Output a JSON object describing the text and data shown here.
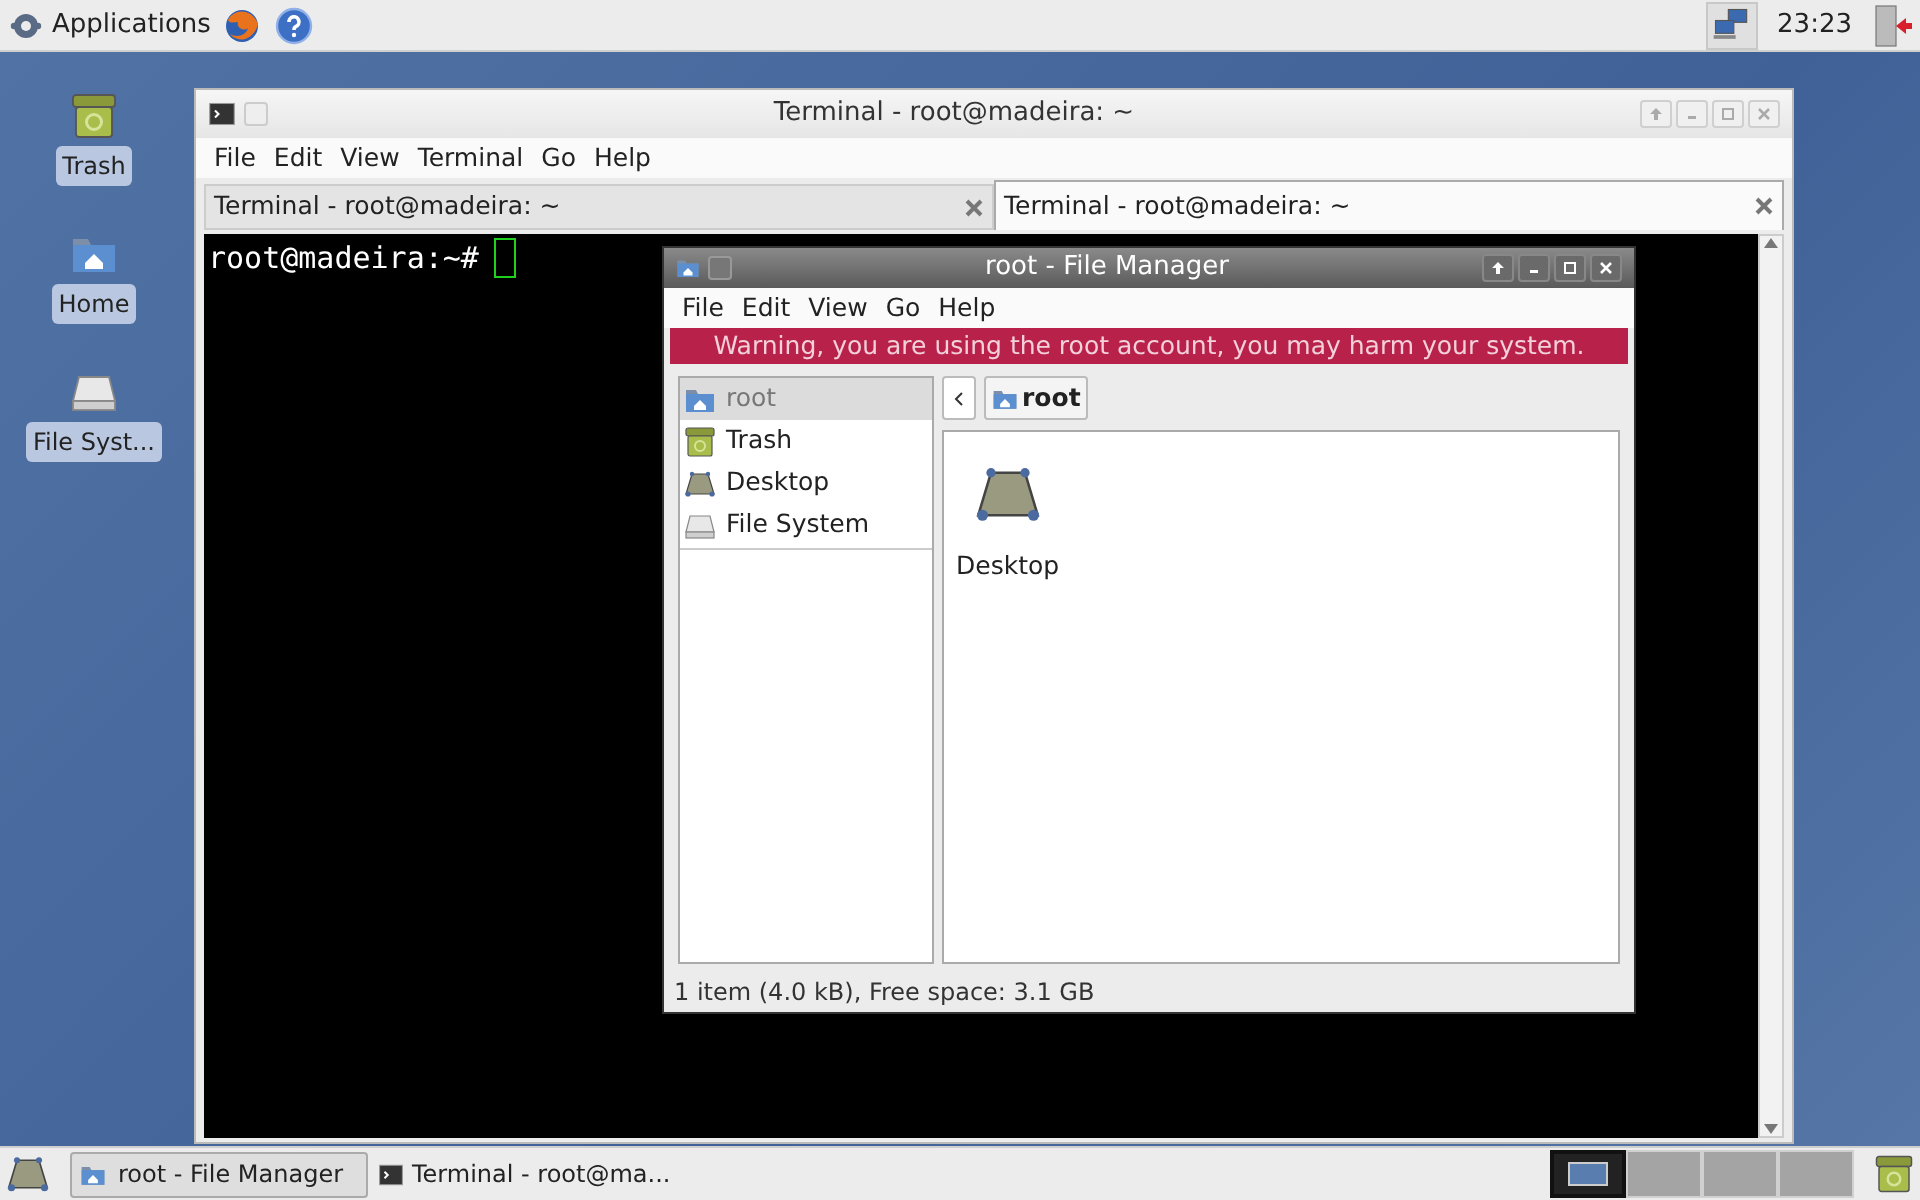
{
  "top_panel": {
    "applications_menu": "Applications",
    "clock": "23:23"
  },
  "desktop_icons": [
    {
      "label": "Trash",
      "kind": "trash"
    },
    {
      "label": "Home",
      "kind": "home"
    },
    {
      "label": "File Syst...",
      "kind": "drive"
    }
  ],
  "terminal_window": {
    "title": "Terminal - root@madeira: ~",
    "menu": [
      "File",
      "Edit",
      "View",
      "Terminal",
      "Go",
      "Help"
    ],
    "tabs": [
      {
        "label": "Terminal - root@madeira: ~",
        "selected": false
      },
      {
        "label": "Terminal - root@madeira: ~",
        "selected": true
      }
    ],
    "prompt": "root@madeira:~#"
  },
  "file_manager": {
    "title": "root - File Manager",
    "menu": [
      "File",
      "Edit",
      "View",
      "Go",
      "Help"
    ],
    "warning": "Warning, you are using the root account, you may harm your system.",
    "sidebar": [
      {
        "label": "root",
        "kind": "home",
        "selected": true
      },
      {
        "label": "Trash",
        "kind": "trash",
        "selected": false
      },
      {
        "label": "Desktop",
        "kind": "desktop",
        "selected": false
      },
      {
        "label": "File System",
        "kind": "drive",
        "selected": false
      }
    ],
    "path_button": "root",
    "items": [
      {
        "label": "Desktop",
        "kind": "desktop"
      }
    ],
    "status": "1 item (4.0 kB), Free space: 3.1 GB"
  },
  "taskbar": {
    "tasks": [
      {
        "label": "root - File Manager",
        "kind": "folder",
        "selected": true
      },
      {
        "label": "Terminal - root@ma...",
        "kind": "terminal",
        "selected": false
      }
    ],
    "workspaces": [
      {
        "selected": true
      },
      {
        "selected": false
      },
      {
        "selected": false
      },
      {
        "selected": false
      }
    ]
  }
}
